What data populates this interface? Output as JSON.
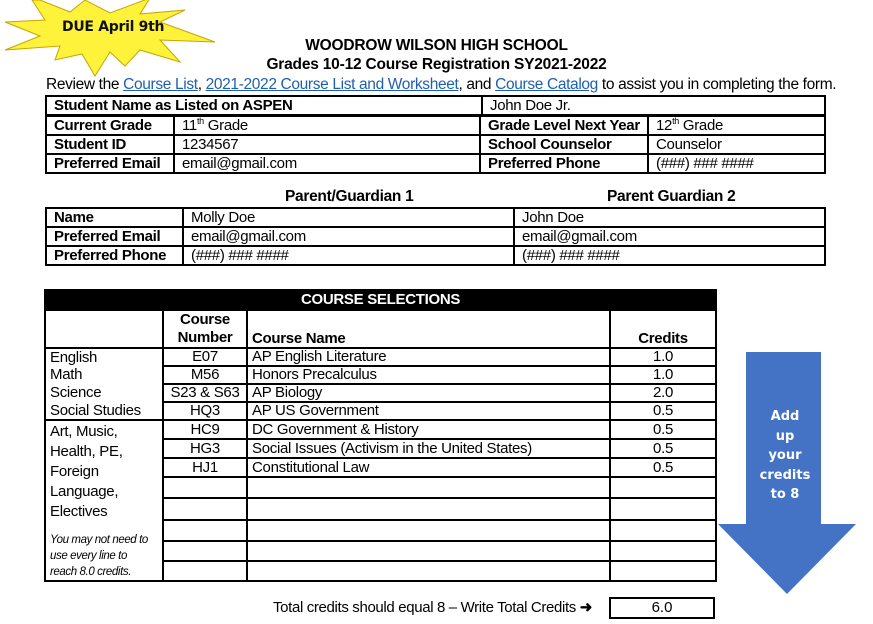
{
  "due_badge": {
    "text": "DUE April 9th",
    "color": "#fff23a"
  },
  "header": {
    "school": "WOODROW WILSON HIGH SCHOOL",
    "form_title": "Grades 10-12 Course Registration SY2021-2022",
    "instructions": {
      "prefix": "Review the ",
      "link1": "Course List",
      "sep1": ", ",
      "link2": "2021-2022 Course List and Worksheet",
      "sep2": ", and ",
      "link3": "Course Catalog",
      "suffix": " to assist you in completing the form."
    }
  },
  "student": {
    "name_label": "Student Name as Listed on ASPEN",
    "name_value": "John Doe Jr.",
    "current_grade_label": "Current Grade",
    "current_grade_num": "11",
    "current_grade_sup": "th",
    "current_grade_suffix": " Grade",
    "next_grade_label": "Grade Level Next Year",
    "next_grade_num": "12",
    "next_grade_sup": "th",
    "next_grade_suffix": " Grade",
    "id_label": "Student ID",
    "id_value": "1234567",
    "counselor_label": "School Counselor",
    "counselor_value": "Counselor",
    "email_label": "Preferred Email",
    "email_value": "email@gmail.com",
    "phone_label": "Preferred Phone",
    "phone_value": "(###) ### ####"
  },
  "guardians": {
    "heading1": "Parent/Guardian 1",
    "heading2": "Parent Guardian 2",
    "rows": [
      {
        "label": "Name",
        "g1": "Molly Doe",
        "g2": "John Doe"
      },
      {
        "label": "Preferred Email",
        "g1": "email@gmail.com",
        "g2": "email@gmail.com"
      },
      {
        "label": "Preferred Phone",
        "g1": "(###) ### ####",
        "g2": "(###) ### ####"
      }
    ]
  },
  "courses": {
    "title": "COURSE SELECTIONS",
    "headers": {
      "number_line1": "Course",
      "number_line2": "Number",
      "name": "Course Name",
      "credits": "Credits"
    },
    "core": [
      {
        "category": "English",
        "number": "E07",
        "name": "AP English Literature",
        "credits": "1.0"
      },
      {
        "category": "Math",
        "number": "M56",
        "name": "Honors Precalculus",
        "credits": "1.0"
      },
      {
        "category": "Science",
        "number": "S23 & S63",
        "name": "AP Biology",
        "credits": "2.0"
      },
      {
        "category": "Social Studies",
        "number": "HQ3",
        "name": "AP US Government",
        "credits": "0.5"
      }
    ],
    "electives_category": [
      "Art, Music,",
      "Health, PE,",
      "Foreign",
      "Language,",
      "Electives"
    ],
    "electives_note": [
      "You may not need to",
      "use every line to",
      "reach 8.0 credits."
    ],
    "electives": [
      {
        "number": "HC9",
        "name": "DC Government & History",
        "credits": "0.5"
      },
      {
        "number": "HG3",
        "name": "Social Issues (Activism in the United States)",
        "credits": "0.5"
      },
      {
        "number": "HJ1",
        "name": "Constitutional Law",
        "credits": "0.5"
      },
      {
        "number": "",
        "name": "",
        "credits": ""
      },
      {
        "number": "",
        "name": "",
        "credits": ""
      },
      {
        "number": "",
        "name": "",
        "credits": ""
      },
      {
        "number": "",
        "name": "",
        "credits": ""
      },
      {
        "number": "",
        "name": "",
        "credits": ""
      }
    ],
    "total_label": "Total credits should equal 8 – Write Total Credits",
    "total_arrow_icon": "right-arrow-icon",
    "total_value": "6.0"
  },
  "arrow_callout": {
    "lines": [
      "Add",
      "up",
      "your",
      "credits",
      "to 8"
    ],
    "color": "#4472c4"
  }
}
